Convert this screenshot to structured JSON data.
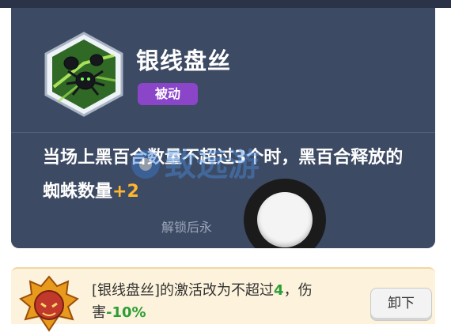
{
  "skill_card": {
    "name": "银线盘丝",
    "type_badge": "被动",
    "description_main": "当场上黑百合数量不超过3个时，黑百合释放的蜘蛛数量",
    "description_bonus": "+2",
    "unlock_note": "解锁后永",
    "watermark": "致远游"
  },
  "upgrade": {
    "text_prefix": "[银线盘丝]的激活改为不超过",
    "count": "4",
    "text_middle": "，伤害",
    "damage": "-10%",
    "button_label": "卸下"
  },
  "colors": {
    "card_bg": "#3d4a63",
    "badge_purple": "#8b45c9",
    "bonus_orange": "#ffb62e",
    "highlight_green": "#2c9e36",
    "panel_cream": "#fdf2db"
  },
  "icons": {
    "skill": "spider-web-skill-icon",
    "upgrade": "golden-mask-emblem-icon"
  }
}
